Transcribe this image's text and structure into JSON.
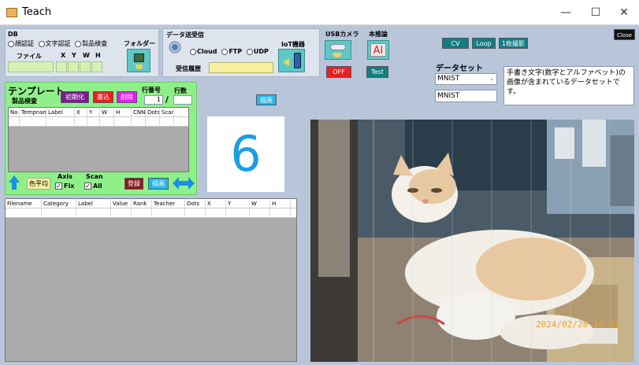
{
  "window": {
    "title": "Teach",
    "minimize": "—",
    "maximize": "☐",
    "close": "✕"
  },
  "db": {
    "group_label": "DB",
    "radio_face": "顔認証",
    "radio_char": "文字認証",
    "radio_product": "製品検査",
    "folder_label": "フォルダー",
    "file_label": "ファイル",
    "x_label": "X",
    "y_label": "Y",
    "w_label": "W",
    "h_label": "H"
  },
  "data_transfer": {
    "group_label": "データ送受信",
    "radio_cloud": "Cloud",
    "radio_ftp": "FTP",
    "radio_udp": "UDP",
    "iot_label": "IoT機器",
    "recv_history_label": "受信履歴",
    "recv_history_value": ""
  },
  "usb_camera": {
    "label": "USBカメラ",
    "off_button": "OFF"
  },
  "inference": {
    "label": "本推論",
    "ai_button": "AI",
    "test_button": "Test"
  },
  "top_buttons": {
    "cv": "CV",
    "loop": "Loop",
    "capture": "1枚撮影",
    "close": "Close"
  },
  "dataset": {
    "label": "データセット",
    "selected": "MNIST",
    "name_value": "MNIST",
    "description": "手書き文字(数字とアルファベット)の画像が含まれているデータセットです。"
  },
  "template": {
    "title": "テンプレート",
    "subtitle": "製品検査",
    "init_button": "初期化",
    "write_button": "書込",
    "delete_button": "削除",
    "row_no_label": "行番号",
    "row_count_label": "行数",
    "row_no_value": "1",
    "row_sep": "/",
    "row_count_value": "",
    "columns": [
      "No",
      "Tempname",
      "Label",
      "X",
      "Y",
      "W",
      "H",
      "CNN",
      "Dots",
      "Scan"
    ],
    "avg_color_button": "色平均",
    "axis_label": "Axis",
    "axis_fix": "Fix",
    "scan_label": "Scan",
    "scan_all": "All",
    "register_button": "登録",
    "draw_button": "描画"
  },
  "draw_button_top": "描画",
  "preview_digit": "6",
  "results_table": {
    "columns": [
      "Filename",
      "Category",
      "Label",
      "Value",
      "Rank",
      "Teacher",
      "Dots",
      "X",
      "Y",
      "W",
      "H"
    ]
  },
  "photo": {
    "timestamp": "2024/02/28 14:41"
  }
}
